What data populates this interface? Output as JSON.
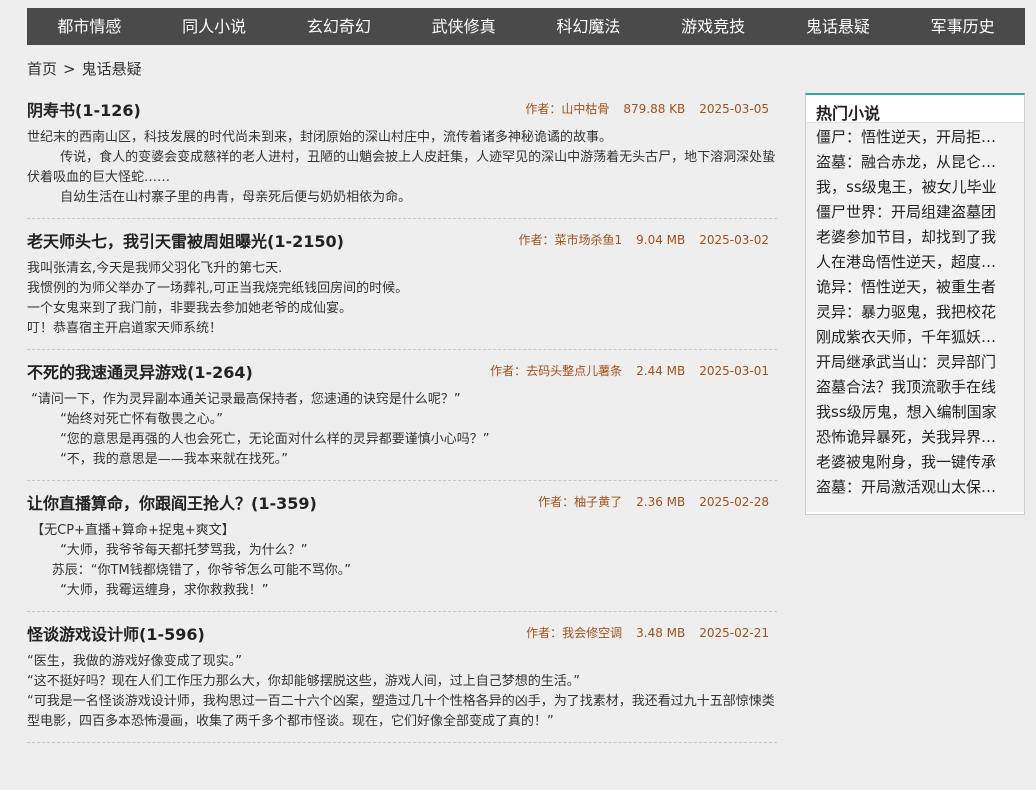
{
  "nav": {
    "items": [
      "都市情感",
      "同人小说",
      "玄幻奇幻",
      "武侠修真",
      "科幻魔法",
      "游戏竞技",
      "鬼话悬疑",
      "军事历史"
    ]
  },
  "breadcrumb": {
    "home": "首页",
    "separator": ">",
    "current": "鬼话悬疑"
  },
  "books": [
    {
      "title": "阴寿书(1-126)",
      "author": "作者：山中枯骨",
      "size": "879.88 KB",
      "date": "2025-03-05",
      "desc": [
        "世纪末的西南山区，科技发展的时代尚未到来，封闭原始的深山村庄中，流传着诸多神秘诡谲的故事。",
        "        传说，食人的变婆会变成慈祥的老人进村，丑陋的山魈会披上人皮赶集，人迹罕见的深山中游荡着无头古尸，地下溶洞深处蛰伏着吸血的巨大怪蛇……",
        "        自幼生活在山村寨子里的冉青，母亲死后便与奶奶相依为命。"
      ]
    },
    {
      "title": "老天师头七，我引天雷被周姐曝光(1-2150)",
      "author": "作者：菜市场杀鱼1",
      "size": "9.04 MB",
      "date": "2025-03-02",
      "desc": [
        "我叫张清玄,今天是我师父羽化飞升的第七天.",
        "我惯例的为师父举办了一场葬礼,可正当我烧完纸钱回房间的时候。",
        "一个女鬼来到了我门前，非要我去参加她老爷的成仙宴。",
        "叮！恭喜宿主开启道家天师系统！"
      ]
    },
    {
      "title": "不死的我速通灵异游戏(1-264)",
      "author": "作者：去码头整点儿薯条",
      "size": "2.44 MB",
      "date": "2025-03-01",
      "desc": [
        " “请问一下，作为灵异副本通关记录最高保持者，您速通的诀窍是什么呢？”",
        "        “始终对死亡怀有敬畏之心。”",
        "        “您的意思是再强的人也会死亡，无论面对什么样的灵异都要谨慎小心吗？”",
        "        “不，我的意思是——我本来就在找死。”"
      ]
    },
    {
      "title": "让你直播算命，你跟阎王抢人？(1-359)",
      "author": "作者：柚子黄了",
      "size": "2.36 MB",
      "date": "2025-02-28",
      "desc": [
        " 【无CP+直播+算命+捉鬼+爽文】",
        "        “大师，我爷爷每天都托梦骂我，为什么？”",
        "      苏辰：“你TM钱都烧错了，你爷爷怎么可能不骂你。”",
        "        “大师，我霉运缠身，求你救救我！”"
      ]
    },
    {
      "title": "怪谈游戏设计师(1-596)",
      "author": "作者：我会修空调",
      "size": "3.48 MB",
      "date": "2025-02-21",
      "desc": [
        "“医生，我做的游戏好像变成了现实。”",
        "“这不挺好吗？现在人们工作压力那么大，你却能够摆脱这些，游戏人间，过上自己梦想的生活。”",
        "“可我是一名怪谈游戏设计师，我构思过一百二十六个凶案，塑造过几十个性格各异的凶手，为了找素材，我还看过九十五部惊悚类型电影，四百多本恐怖漫画，收集了两千多个都市怪谈。现在，它们好像全部变成了真的！”"
      ]
    }
  ],
  "sidebar": {
    "title": "热门小说",
    "items": [
      "僵尸：悟性逆天，开局拒绝九叔",
      "盗墓：融合赤龙，从昆仑开始",
      "我，ss级鬼王，被女儿毕业",
      "僵尸世界：开局组建盗墓团",
      "老婆参加节目，却找到了我",
      "人在港岛悟性逆天，超度万鬼",
      "诡异：悟性逆天，被重生者",
      "灵异：暴力驱鬼，我把校花",
      "刚成紫衣天师，千年狐妖找上门",
      "开局继承武当山：灵异部门",
      "盗墓合法？我顶流歌手在线",
      "我ss级厉鬼，想入编制国家",
      "恐怖诡异暴死，关我异界亡灵",
      "老婆被鬼附身，我一键传承",
      "盗墓：开局激活观山太保传承"
    ]
  }
}
